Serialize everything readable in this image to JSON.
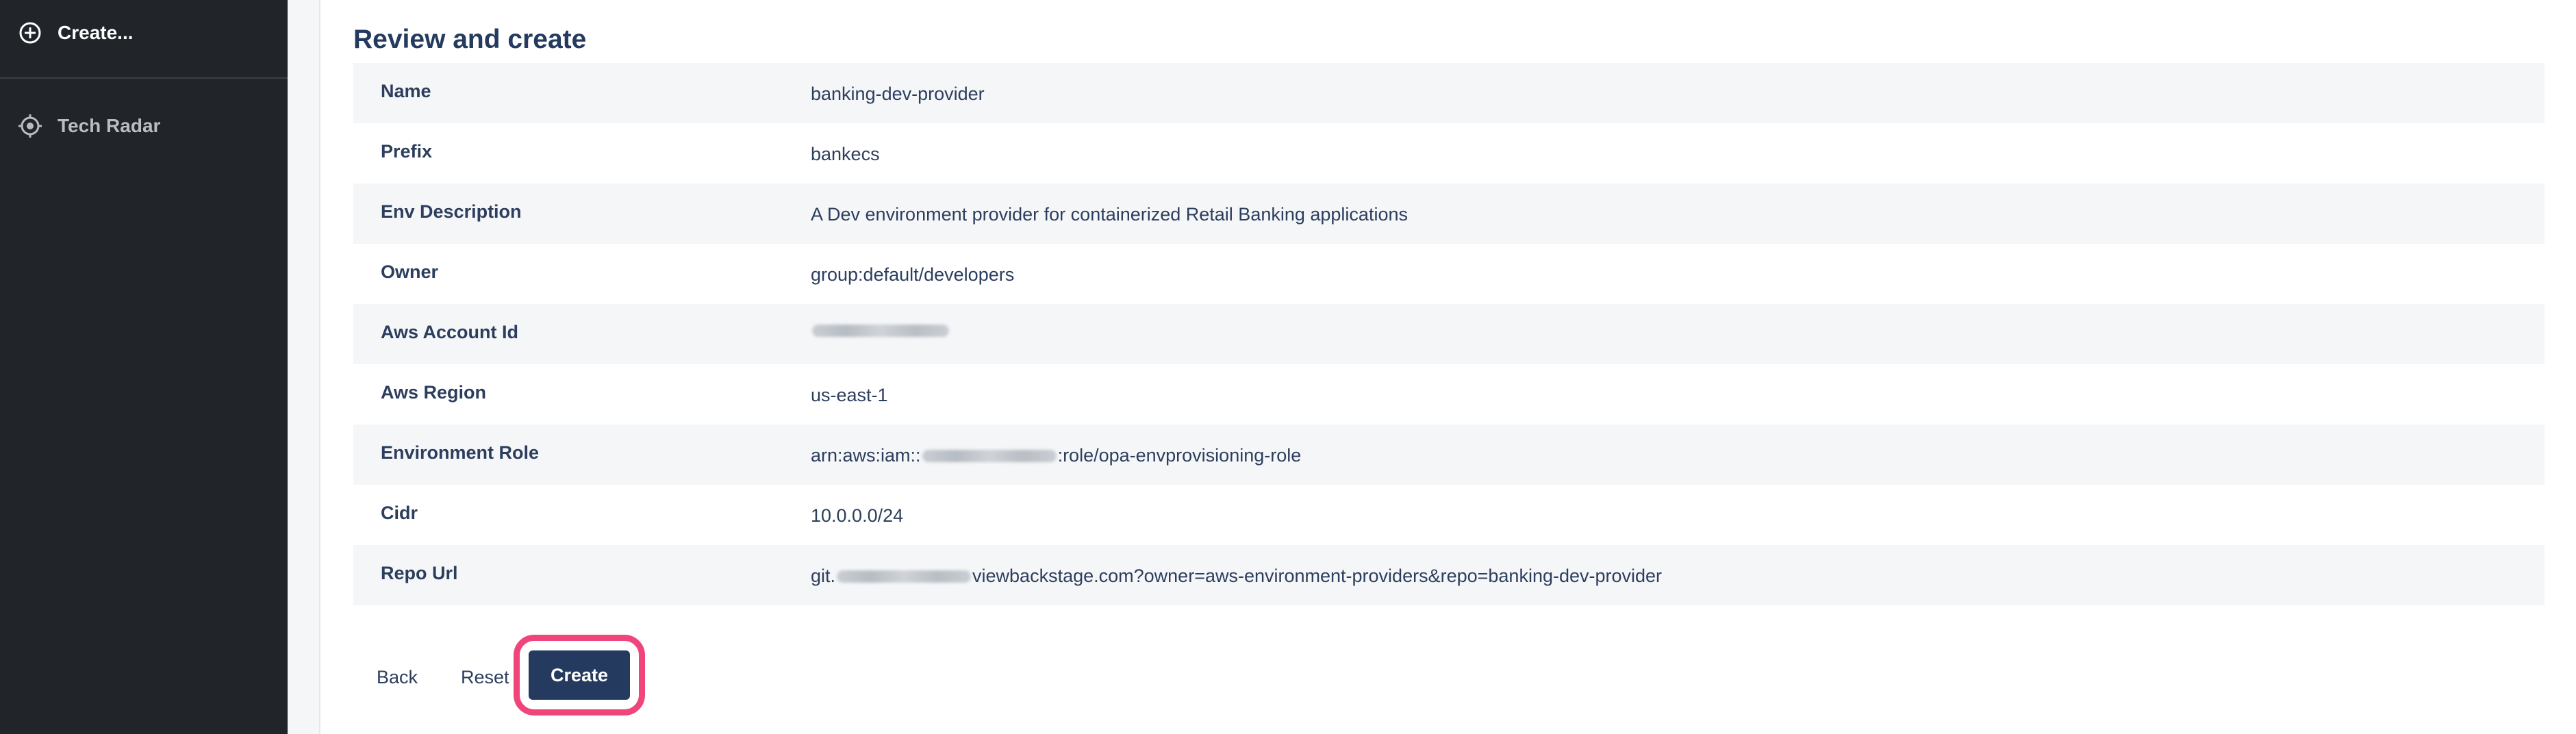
{
  "sidebar": {
    "create_label": "Create...",
    "tech_radar_label": "Tech Radar"
  },
  "main": {
    "title": "Review and create",
    "rows": [
      {
        "label": "Name",
        "value": "banking-dev-provider"
      },
      {
        "label": "Prefix",
        "value": "bankecs"
      },
      {
        "label": "Env Description",
        "value": "A Dev environment provider for containerized Retail Banking applications"
      },
      {
        "label": "Owner",
        "value": "group:default/developers"
      },
      {
        "label": "Aws Account Id",
        "value": ""
      },
      {
        "label": "Aws Region",
        "value": "us-east-1"
      },
      {
        "label": "Environment Role",
        "value_prefix": "arn:aws:iam::",
        "value_suffix": ":role/opa-envprovisioning-role"
      },
      {
        "label": "Cidr",
        "value": "10.0.0.0/24"
      },
      {
        "label": "Repo Url",
        "value_prefix": "git.",
        "value_suffix": "viewbackstage.com?owner=aws-environment-providers&repo=banking-dev-provider"
      }
    ]
  },
  "footer": {
    "back_label": "Back",
    "reset_label": "Reset",
    "create_label": "Create"
  },
  "colors": {
    "sidebar_bg": "#212529",
    "primary": "#243a5e",
    "highlight": "#f0457a"
  },
  "icons": {
    "create": "add-circle-icon",
    "tech_radar": "radar-icon"
  }
}
